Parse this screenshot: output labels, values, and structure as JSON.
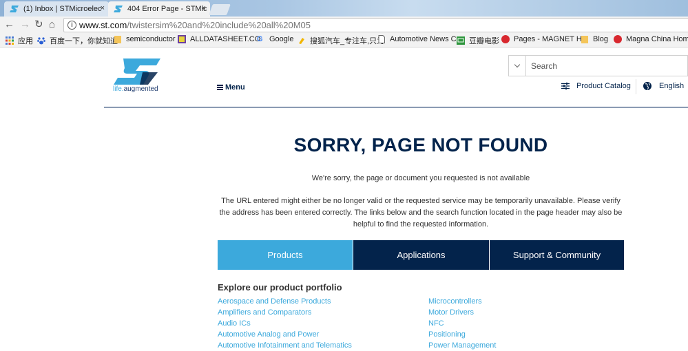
{
  "browser": {
    "tabs": [
      {
        "title": "(1) Inbox | STMicroelec",
        "active": false
      },
      {
        "title": "404 Error Page - STMic",
        "active": true
      }
    ],
    "close_glyph": "×",
    "nav": {
      "back": "←",
      "forward": "→",
      "reload": "↻",
      "home": "⌂"
    },
    "address": {
      "host": "www.st.com",
      "path": "/twistersim%20and%20include%20all%20M05",
      "info_glyph": "i"
    },
    "bookmarks": [
      {
        "label": "应用",
        "icon": "apps-grid-icon"
      },
      {
        "label": "百度一下，你就知道",
        "icon": "baidu-paw-icon"
      },
      {
        "label": "semiconductor",
        "icon": "folder-icon"
      },
      {
        "label": "ALLDATASHEET.CO",
        "icon": "datasheet-icon"
      },
      {
        "label": "Google",
        "icon": "google-g-icon"
      },
      {
        "label": "搜狐汽车_专注车,只为",
        "icon": "sohu-icon"
      },
      {
        "label": "Automotive News C",
        "icon": "page-icon"
      },
      {
        "label": "豆瓣电影",
        "icon": "douban-icon"
      },
      {
        "label": "Pages - MAGNET H",
        "icon": "magnet-icon"
      },
      {
        "label": "Blog",
        "icon": "folder-icon"
      },
      {
        "label": "Magna China Home",
        "icon": "magna-icon"
      }
    ]
  },
  "site": {
    "logo_tagline_life": "life.",
    "logo_tagline_aug": "augmented",
    "menu_label": "Menu",
    "search_placeholder": "Search",
    "catalog_label": "Product Catalog",
    "language_label": "English",
    "colors": {
      "navy": "#03234b",
      "accent": "#3ca9dc"
    }
  },
  "error": {
    "title": "SORRY, PAGE NOT FOUND",
    "subtitle": "We're sorry, the page or document you requested is not available",
    "description": "The URL entered might either be no longer valid or the requested service may be temporarily unavailable. Please verify the address has been entered correctly. The links below and the search function located in the page header may also be helpful to find the requested information."
  },
  "portfolio_tabs": [
    "Products",
    "Applications",
    "Support & Community"
  ],
  "explore": {
    "heading": "Explore our product portfolio",
    "left_links": [
      "Aerospace and Defense Products",
      "Amplifiers and Comparators",
      "Audio ICs",
      "Automotive Analog and Power",
      "Automotive Infotainment and Telematics"
    ],
    "right_links": [
      "Microcontrollers",
      "Motor Drivers",
      "NFC",
      "Positioning",
      "Power Management"
    ]
  }
}
